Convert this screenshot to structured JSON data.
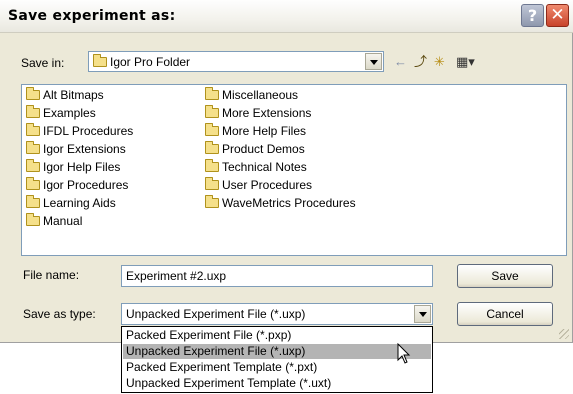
{
  "window": {
    "title": "Save experiment as:"
  },
  "titlebar": {
    "help_glyph": "?",
    "close_glyph": "✕"
  },
  "save_in": {
    "label": "Save in:",
    "value": "Igor Pro Folder"
  },
  "toolbar": {
    "back_icon": "←",
    "up_icon": "⤴",
    "new_folder_icon": "✳",
    "views_icon": "▦▾"
  },
  "files": {
    "column1": [
      "Alt Bitmaps",
      "Examples",
      "IFDL Procedures",
      "Igor Extensions",
      "Igor Help Files",
      "Igor Procedures",
      "Learning Aids",
      "Manual"
    ],
    "column2": [
      "Miscellaneous",
      "More Extensions",
      "More Help Files",
      "Product Demos",
      "Technical Notes",
      "User Procedures",
      "WaveMetrics Procedures"
    ]
  },
  "file_name": {
    "label": "File name:",
    "value": "Experiment #2.uxp"
  },
  "save_as_type": {
    "label": "Save as type:",
    "value": "Unpacked Experiment File (*.uxp)",
    "options": [
      "Packed Experiment File (*.pxp)",
      "Unpacked Experiment File (*.uxp)",
      "Packed Experiment Template (*.pxt)",
      "Unpacked Experiment Template (*.uxt)"
    ],
    "highlighted_index": 1
  },
  "buttons": {
    "save": "Save",
    "cancel": "Cancel"
  }
}
